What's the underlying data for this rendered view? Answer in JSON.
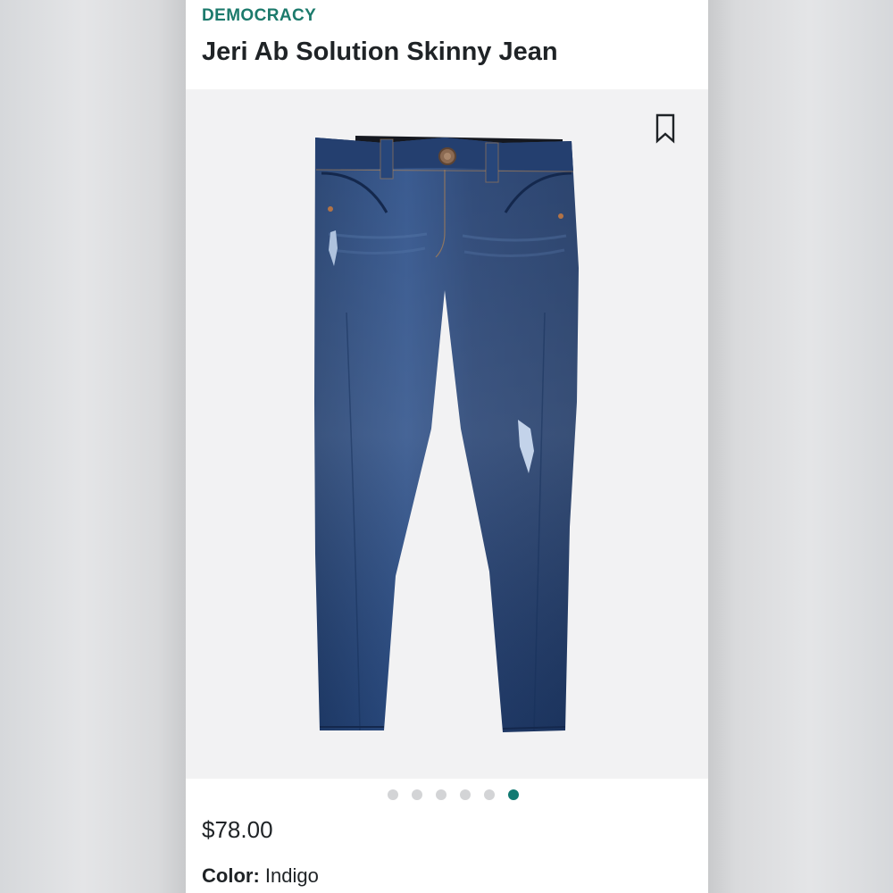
{
  "product": {
    "brand": "DEMOCRACY",
    "title": "Jeri Ab Solution Skinny Jean",
    "price": "$78.00",
    "color_label": "Color:",
    "color_value": "Indigo"
  },
  "gallery": {
    "image_count": 6,
    "active_index": 5
  },
  "icons": {
    "bookmark": "bookmark-icon"
  },
  "colors": {
    "brand_accent": "#1c7a6c",
    "dot_active": "#127a72",
    "dot_inactive": "#d3d4d6",
    "denim": "#2a4a80"
  }
}
